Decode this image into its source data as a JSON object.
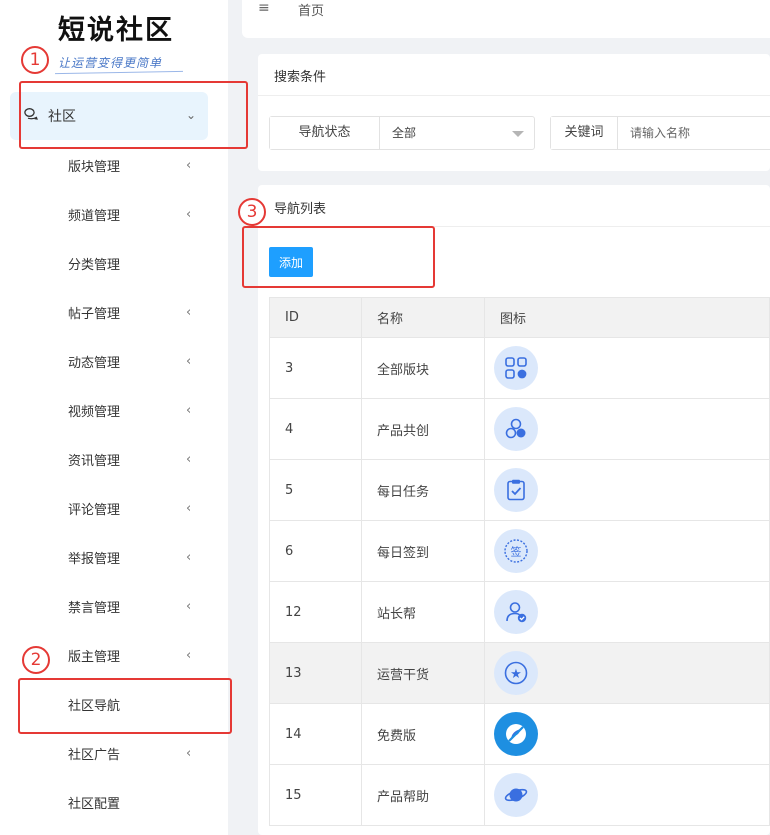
{
  "sidebar": {
    "logo": "短说社区",
    "slogan": "让运营变得更简单",
    "community": {
      "label": "社区"
    },
    "items": [
      {
        "label": "版块管理",
        "chevron": true
      },
      {
        "label": "频道管理",
        "chevron": true
      },
      {
        "label": "分类管理",
        "chevron": false
      },
      {
        "label": "帖子管理",
        "chevron": true
      },
      {
        "label": "动态管理",
        "chevron": true
      },
      {
        "label": "视频管理",
        "chevron": true
      },
      {
        "label": "资讯管理",
        "chevron": true
      },
      {
        "label": "评论管理",
        "chevron": true
      },
      {
        "label": "举报管理",
        "chevron": true
      },
      {
        "label": "禁言管理",
        "chevron": true
      },
      {
        "label": "版主管理",
        "chevron": true
      },
      {
        "label": "社区导航",
        "chevron": false
      },
      {
        "label": "社区广告",
        "chevron": true
      },
      {
        "label": "社区配置",
        "chevron": false
      }
    ]
  },
  "annotations": {
    "one": "1",
    "two": "2",
    "three": "3"
  },
  "topbar": {
    "hamburger": "≡",
    "breadcrumb": "首页"
  },
  "search": {
    "title": "搜索条件",
    "status_label": "导航状态",
    "status_value": "全部",
    "keyword_label": "关键词",
    "keyword_placeholder": "请输入名称"
  },
  "list": {
    "title": "导航列表",
    "add_label": "添加",
    "columns": [
      "ID",
      "名称",
      "图标"
    ],
    "rows": [
      {
        "id": "3",
        "name": "全部版块",
        "icon": "apps-grid-icon"
      },
      {
        "id": "4",
        "name": "产品共创",
        "icon": "co-create-icon"
      },
      {
        "id": "5",
        "name": "每日任务",
        "icon": "clipboard-check-icon"
      },
      {
        "id": "6",
        "name": "每日签到",
        "icon": "sign-in-icon"
      },
      {
        "id": "12",
        "name": "站长帮",
        "icon": "user-check-icon"
      },
      {
        "id": "13",
        "name": "运营干货",
        "icon": "star-icon"
      },
      {
        "id": "14",
        "name": "免费版",
        "icon": "free-version-icon"
      },
      {
        "id": "15",
        "name": "产品帮助",
        "icon": "planet-icon"
      }
    ]
  },
  "colors": {
    "accent": "#1e9fff",
    "annotation": "#e53935",
    "active_bg": "#e8f4fd"
  },
  "glyphs": {
    "chevron_down": "⌄",
    "chevron_left": "‹",
    "star": "★",
    "sign": "签"
  }
}
